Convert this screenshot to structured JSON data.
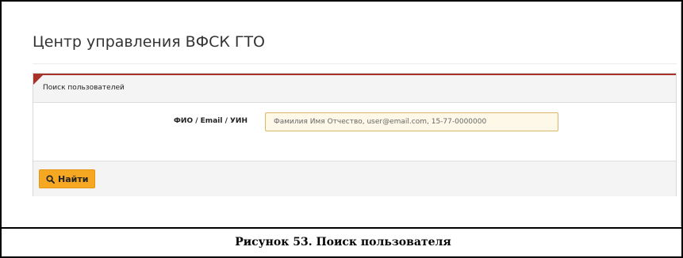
{
  "app": {
    "title": "Центр управления ВФСК ГТО"
  },
  "panel": {
    "title": "Поиск пользователей",
    "field_label": "ФИО / Email / УИН",
    "search_placeholder": "Фамилия Имя Отчество, user@email.com, 15-77-0000000",
    "search_value": "",
    "find_button_label": "Найти",
    "find_icon": "search-icon"
  },
  "caption": {
    "text": "Рисунок 53. Поиск пользователя"
  },
  "colors": {
    "accent_red": "#a8322a",
    "button_orange": "#f7a823",
    "input_bg": "#fdf8e8"
  }
}
